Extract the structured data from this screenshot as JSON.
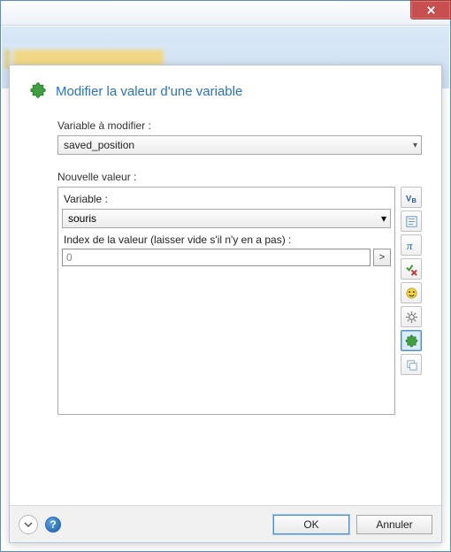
{
  "window": {
    "title": ""
  },
  "dialog": {
    "title": "Modifier la valeur d'une variable",
    "var_label": "Variable à modifier :",
    "var_value": "saved_position",
    "newval_label": "Nouvelle valeur :",
    "panel": {
      "type_label": "Variable :",
      "var_select": "souris",
      "index_label": "Index de la valeur (laisser vide s'il n'y en a pas) :",
      "index_value": "0",
      "go_label": ">"
    },
    "tools": [
      {
        "name": "vb-icon"
      },
      {
        "name": "text-icon"
      },
      {
        "name": "pi-icon"
      },
      {
        "name": "check-x-icon"
      },
      {
        "name": "face-icon"
      },
      {
        "name": "gear-icon"
      },
      {
        "name": "puzzle-icon"
      },
      {
        "name": "copy-icon"
      }
    ]
  },
  "buttons": {
    "ok": "OK",
    "cancel": "Annuler",
    "help": "?"
  }
}
